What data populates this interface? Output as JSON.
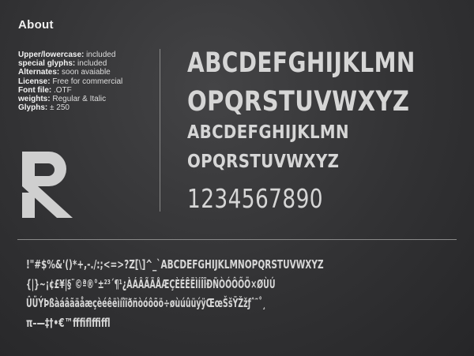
{
  "about": {
    "heading": "About",
    "specs": [
      {
        "label": "Upper/lowercase:",
        "value": "included"
      },
      {
        "label": "special glyphs:",
        "value": "included"
      },
      {
        "label": "Alternates:",
        "value": "soon avaiable"
      },
      {
        "label": "License:",
        "value": "Free for commercial"
      },
      {
        "label": "Font file:",
        "value": ".OTF"
      },
      {
        "label": "weights:",
        "value": "Regular & Italic"
      },
      {
        "label": "Glyphs:",
        "value": "± 250"
      }
    ]
  },
  "logo": {
    "icon": "stylized-r-logo",
    "color": "#cfcfcf"
  },
  "specimen": {
    "upper_line_1": "ABCDEFGHIJKLMN",
    "upper_line_2": "OPQRSTUVWXYZ",
    "lower_line_1": "ABCDEFGHIJKLMN",
    "lower_line_2": "OPQRSTUVWXYZ",
    "numerals": "1234567890"
  },
  "charset": {
    "line_1": "!\"#$%&'()*+,-./:;<=>?Z[\\]^_`ABCDEFGHIJKLMNOPQRSTUVWXYZ",
    "line_2": "{|}~¡¢£¥|§¨©ª®°±²³´¶¹¿ÀÁÂÃÄÅÆÇÈÉÊËÌÍÎÏÐÑÒÓÔÕÖ×ØÙÚ",
    "line_3": "ÛÜÝÞßàáâãäåæçèéêëìíîïðñòóôõö÷øùúûüýÿŒœŠšŸŽžƒˆ˜˚¸",
    "line_4": "π–—‡†•€™ﬀﬁﬂﬃﬄ"
  },
  "colors": {
    "background": "#333335",
    "text": "#d6d6d6",
    "divider": "#8a8a8a"
  }
}
